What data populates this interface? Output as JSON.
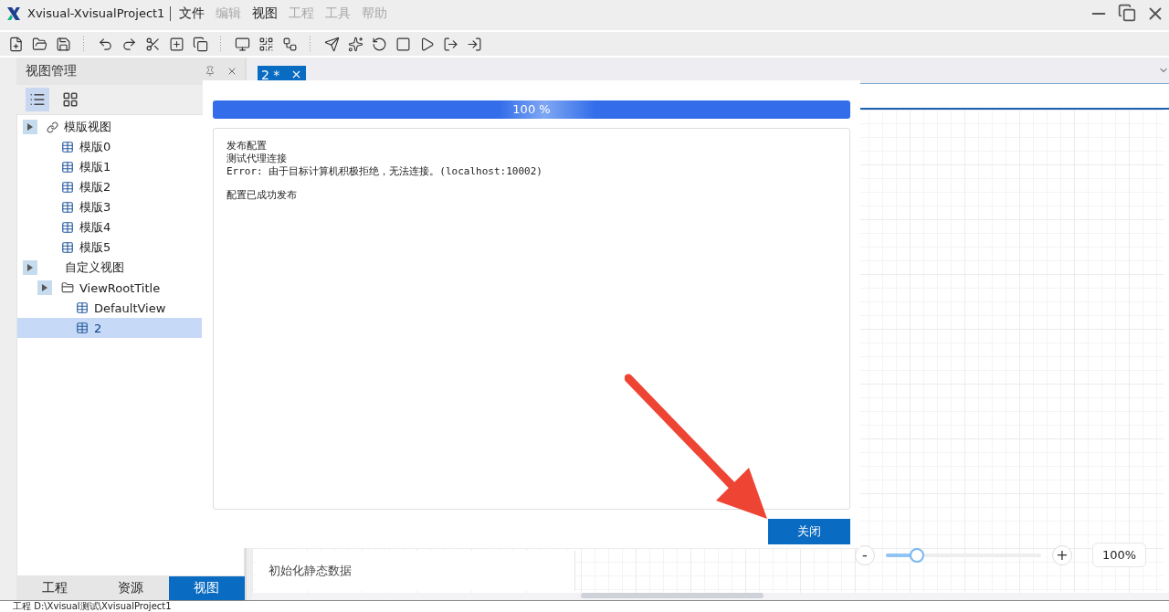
{
  "window": {
    "title": "Xvisual-XvisualProject1"
  },
  "menu": [
    {
      "label": "文件",
      "disabled": false
    },
    {
      "label": "编辑",
      "disabled": true
    },
    {
      "label": "视图",
      "disabled": false
    },
    {
      "label": "工程",
      "disabled": true
    },
    {
      "label": "工具",
      "disabled": true
    },
    {
      "label": "帮助",
      "disabled": true
    }
  ],
  "side_panel": {
    "title": "视图管理",
    "view_modes": [
      {
        "kind": "list",
        "selected": true
      },
      {
        "kind": "grid",
        "selected": false
      }
    ],
    "tree": [
      {
        "label": "模版视图",
        "kind": "group",
        "selected": false,
        "children": [
          {
            "label": "模版0",
            "kind": "table",
            "selected": false
          },
          {
            "label": "模版1",
            "kind": "table",
            "selected": false
          },
          {
            "label": "模版2",
            "kind": "table",
            "selected": false
          },
          {
            "label": "模版3",
            "kind": "table",
            "selected": false
          },
          {
            "label": "模版4",
            "kind": "table",
            "selected": false
          },
          {
            "label": "模版5",
            "kind": "table",
            "selected": false
          }
        ]
      },
      {
        "label": "自定义视图",
        "kind": "plain",
        "selected": false,
        "children": [
          {
            "label": "ViewRootTitle",
            "kind": "root",
            "selected": false,
            "children": [
              {
                "label": "DefaultView",
                "kind": "table",
                "selected": false
              },
              {
                "label": "2",
                "kind": "table",
                "selected": true
              }
            ]
          }
        ]
      }
    ],
    "tabs": [
      {
        "label": "工程",
        "selected": false
      },
      {
        "label": "资源",
        "selected": false
      },
      {
        "label": "视图",
        "selected": true
      }
    ]
  },
  "editor_tabs": [
    {
      "label": "2 *",
      "selected": true
    }
  ],
  "bottom_panel": {
    "label": "初始化静态数据"
  },
  "zoom": {
    "minus": "-",
    "plus": "+",
    "level": 0.2,
    "reading": "100%"
  },
  "dialog": {
    "progress": {
      "level": 1,
      "reading": "100 %"
    },
    "log": [
      [
        {
          "text": "发布配置",
          "kind": "plain"
        },
        {
          "text": "测试代理连接",
          "kind": "plain"
        },
        {
          "text": "Error: 由于目标计算机积极拒绝，无法连接。(localhost:10002)",
          "kind": "code"
        }
      ],
      [
        {
          "text": "配置已成功发布",
          "kind": "plain"
        }
      ]
    ],
    "button": "关闭"
  },
  "status_bar": "工程 D:\\Xvisual测试\\XvisualProject1"
}
